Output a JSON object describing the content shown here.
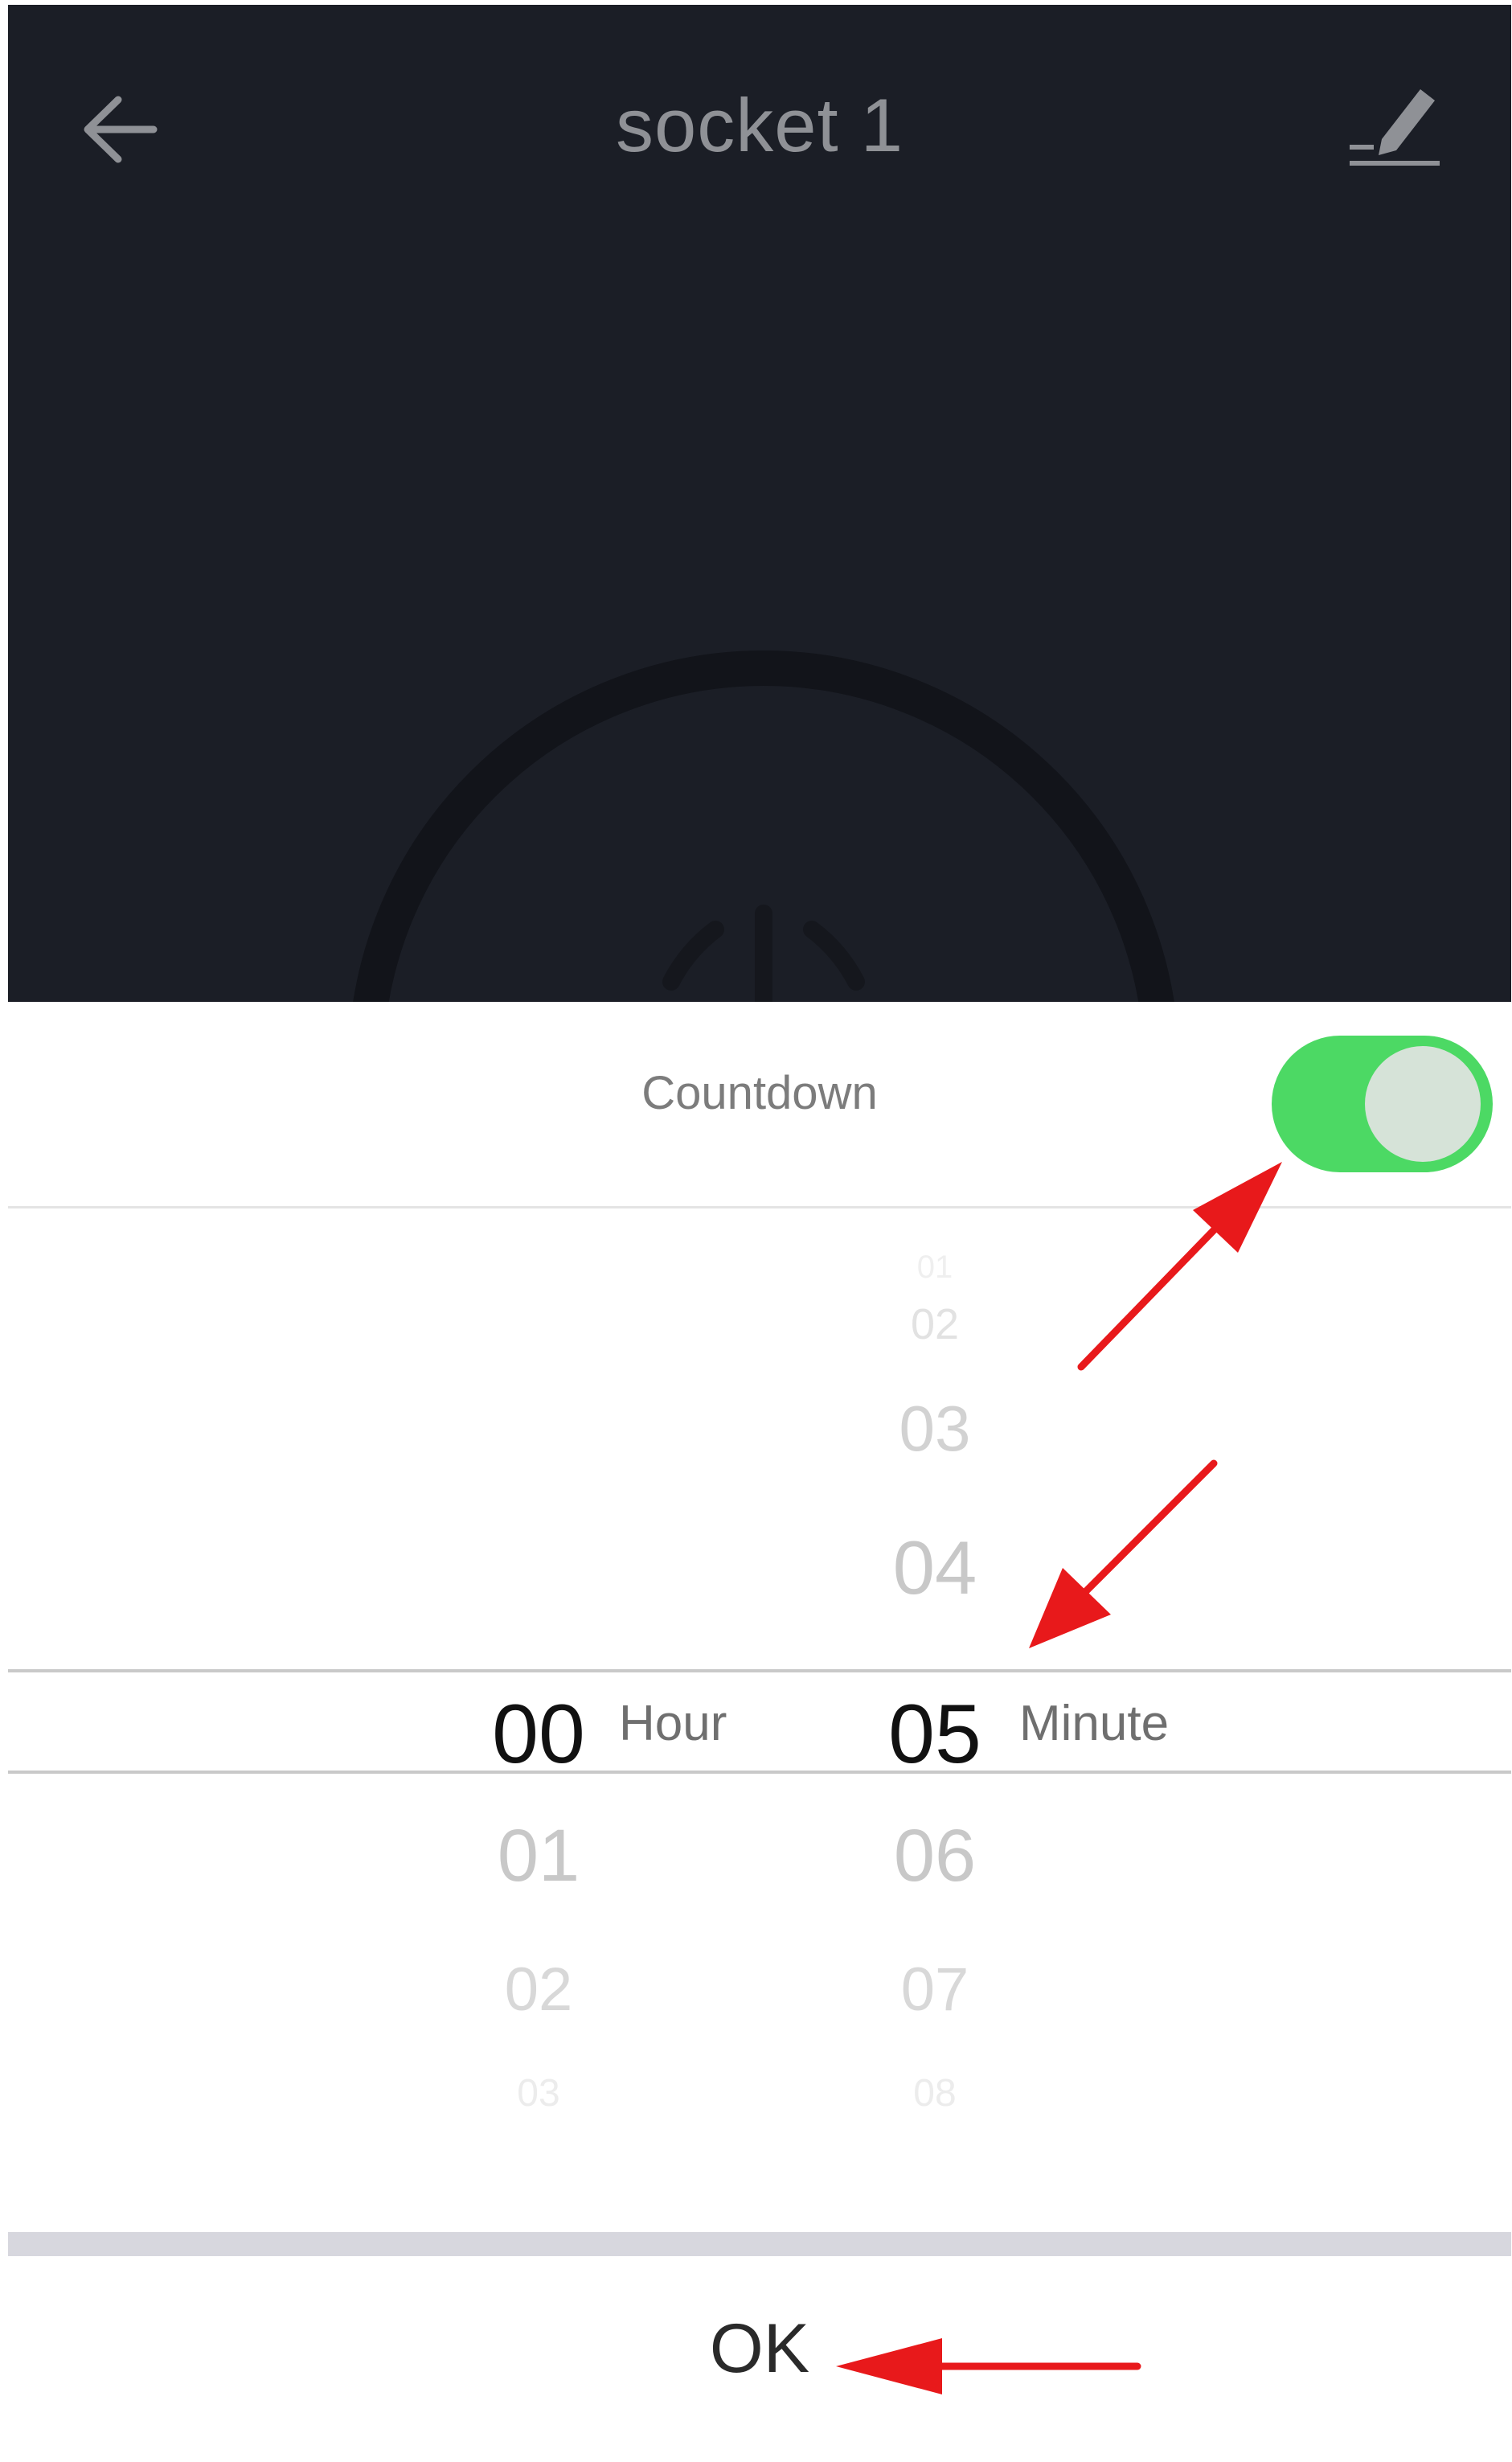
{
  "header": {
    "back_icon": "arrow-left-icon",
    "title": "socket 1",
    "edit_icon": "edit-pencil-icon"
  },
  "countdown": {
    "label": "Countdown",
    "toggle_on": true,
    "toggle_color": "#4cd964"
  },
  "picker": {
    "hours": {
      "above": [],
      "selected": "00",
      "below": [
        "01",
        "02",
        "03"
      ],
      "unit": "Hour"
    },
    "minutes": {
      "above": [
        "01",
        "02",
        "03",
        "04"
      ],
      "selected": "05",
      "below": [
        "06",
        "07",
        "08"
      ],
      "unit": "Minute"
    }
  },
  "confirm_label": "OK",
  "annotation_color": "#e8191b"
}
